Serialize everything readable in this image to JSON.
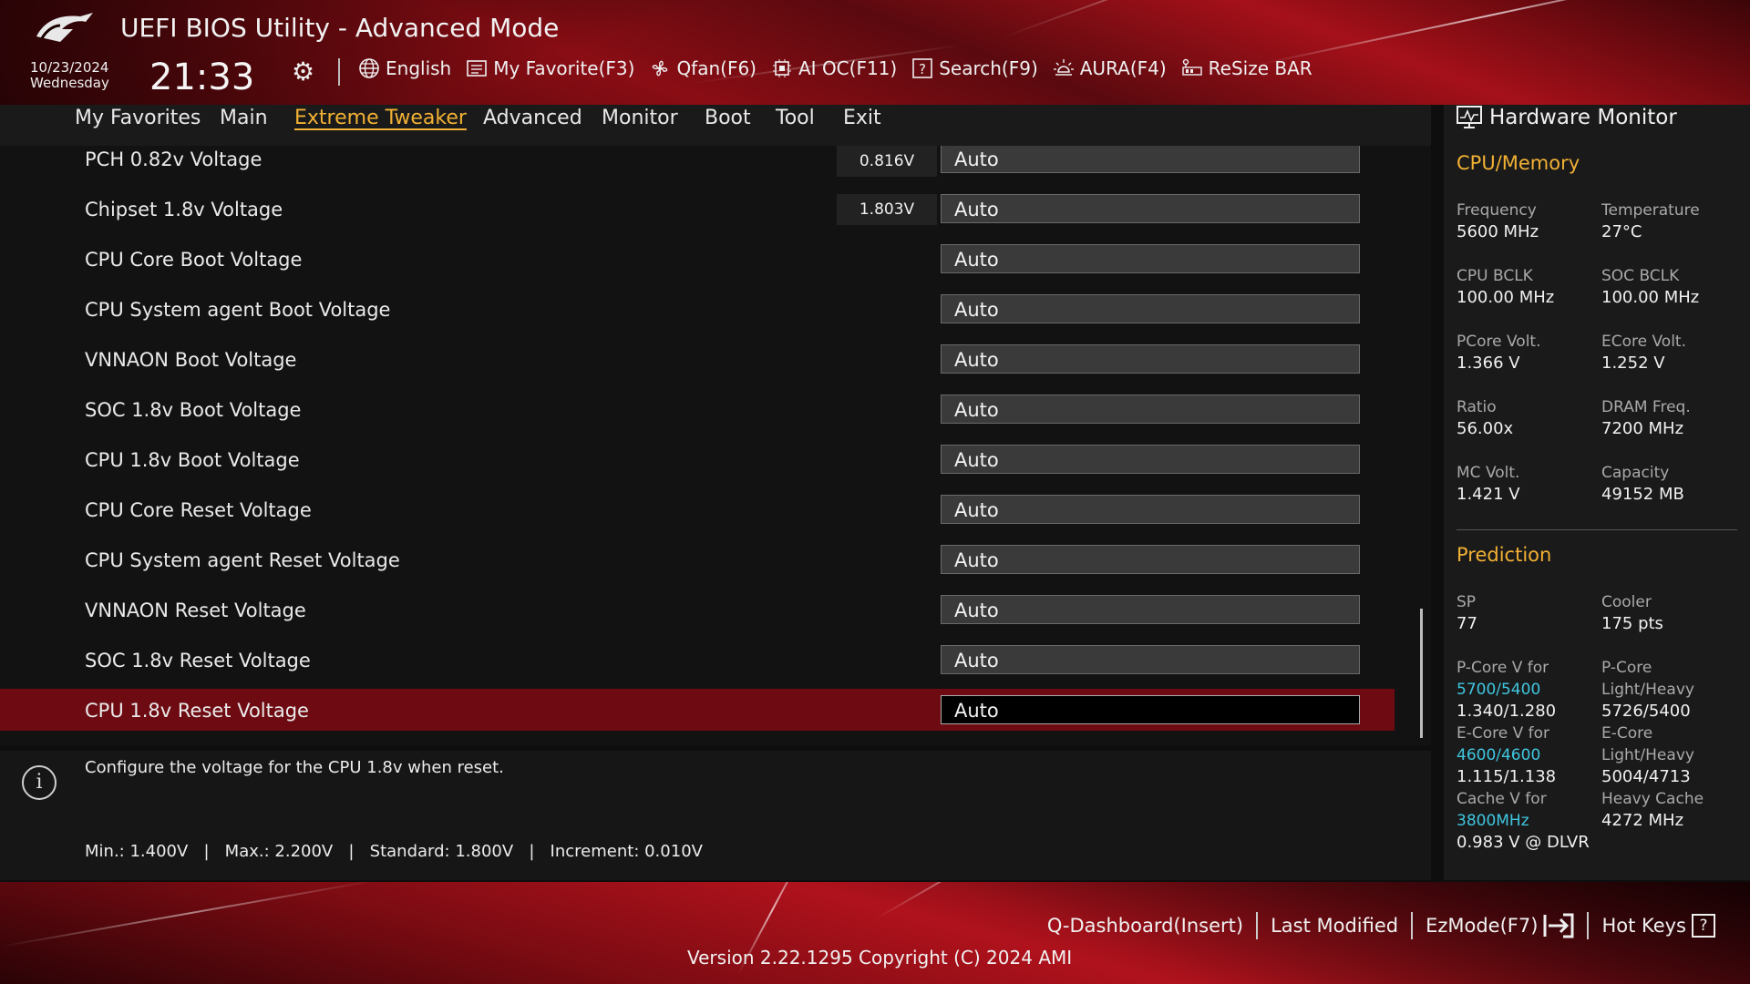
{
  "header": {
    "title": "UEFI BIOS Utility - Advanced Mode",
    "date": "10/23/2024",
    "weekday": "Wednesday",
    "time": "21:33",
    "toolbar": [
      {
        "label": "English",
        "icon": "globe-icon"
      },
      {
        "label": "My Favorite(F3)",
        "icon": "favorite-list-icon"
      },
      {
        "label": "Qfan(F6)",
        "icon": "fan-icon"
      },
      {
        "label": "AI OC(F11)",
        "icon": "ai-oc-icon"
      },
      {
        "label": "Search(F9)",
        "icon": "search-help-icon"
      },
      {
        "label": "AURA(F4)",
        "icon": "aura-light-icon"
      },
      {
        "label": "ReSize BAR",
        "icon": "resize-bar-icon"
      }
    ]
  },
  "nav": {
    "tabs": [
      "My Favorites",
      "Main",
      "Extreme Tweaker",
      "Advanced",
      "Monitor",
      "Boot",
      "Tool",
      "Exit"
    ],
    "active": "Extreme Tweaker"
  },
  "settings": [
    {
      "label": "PCH 0.82v Voltage",
      "reading": "0.816V",
      "value": "Auto"
    },
    {
      "label": "Chipset 1.8v Voltage",
      "reading": "1.803V",
      "value": "Auto"
    },
    {
      "label": "CPU Core Boot Voltage",
      "reading": "",
      "value": "Auto"
    },
    {
      "label": "CPU System agent Boot Voltage",
      "reading": "",
      "value": "Auto"
    },
    {
      "label": "VNNAON Boot Voltage",
      "reading": "",
      "value": "Auto"
    },
    {
      "label": "SOC 1.8v Boot Voltage",
      "reading": "",
      "value": "Auto"
    },
    {
      "label": "CPU 1.8v Boot Voltage",
      "reading": "",
      "value": "Auto"
    },
    {
      "label": "CPU Core Reset Voltage",
      "reading": "",
      "value": "Auto"
    },
    {
      "label": "CPU System agent Reset Voltage",
      "reading": "",
      "value": "Auto"
    },
    {
      "label": "VNNAON Reset Voltage",
      "reading": "",
      "value": "Auto"
    },
    {
      "label": "SOC 1.8v Reset Voltage",
      "reading": "",
      "value": "Auto"
    },
    {
      "label": "CPU 1.8v Reset Voltage",
      "reading": "",
      "value": "Auto",
      "selected": true
    }
  ],
  "info": {
    "description": "Configure the voltage for the CPU 1.8v when reset.",
    "limits": "Min.: 1.400V   |   Max.: 2.200V   |   Standard: 1.800V   |   Increment: 0.010V"
  },
  "hw_monitor": {
    "title": "Hardware Monitor",
    "cpu_memory_title": "CPU/Memory",
    "cpu_memory": [
      {
        "k": "Frequency",
        "v": "5600 MHz"
      },
      {
        "k": "Temperature",
        "v": "27°C"
      },
      {
        "k": "CPU BCLK",
        "v": "100.00 MHz"
      },
      {
        "k": "SOC BCLK",
        "v": "100.00 MHz"
      },
      {
        "k": "PCore Volt.",
        "v": "1.366 V"
      },
      {
        "k": "ECore Volt.",
        "v": "1.252 V"
      },
      {
        "k": "Ratio",
        "v": "56.00x"
      },
      {
        "k": "DRAM Freq.",
        "v": "7200 MHz"
      },
      {
        "k": "MC Volt.",
        "v": "1.421 V"
      },
      {
        "k": "Capacity",
        "v": "49152 MB"
      }
    ],
    "prediction_title": "Prediction",
    "prediction": {
      "sp_label": "SP",
      "sp_value": "77",
      "cooler_label": "Cooler",
      "cooler_value": "175 pts",
      "pcore_v_label": "P-Core V for",
      "pcore_v_link": "5700/5400",
      "pcore_v_value": "1.340/1.280",
      "pcore_lh_label1": "P-Core",
      "pcore_lh_label2": "Light/Heavy",
      "pcore_lh_value": "5726/5400",
      "ecore_v_label": "E-Core V for",
      "ecore_v_link": "4600/4600",
      "ecore_v_value": "1.115/1.138",
      "ecore_lh_label1": "E-Core",
      "ecore_lh_label2": "Light/Heavy",
      "ecore_lh_value": "5004/4713",
      "cache_v_label": "Cache V for",
      "cache_v_link": "3800MHz",
      "cache_v_value": "0.983 V @ DLVR",
      "heavy_cache_label": "Heavy Cache",
      "heavy_cache_value": "4272 MHz"
    }
  },
  "footer": {
    "links": [
      "Q-Dashboard(Insert)",
      "Last Modified",
      "EzMode(F7)",
      "Hot Keys"
    ],
    "version": "Version 2.22.1295 Copyright (C) 2024 AMI"
  },
  "colors": {
    "accent": "#f2b134",
    "link": "#3fc6e0",
    "selected_row": "#6e0b12",
    "brand_red": "#a51019"
  }
}
